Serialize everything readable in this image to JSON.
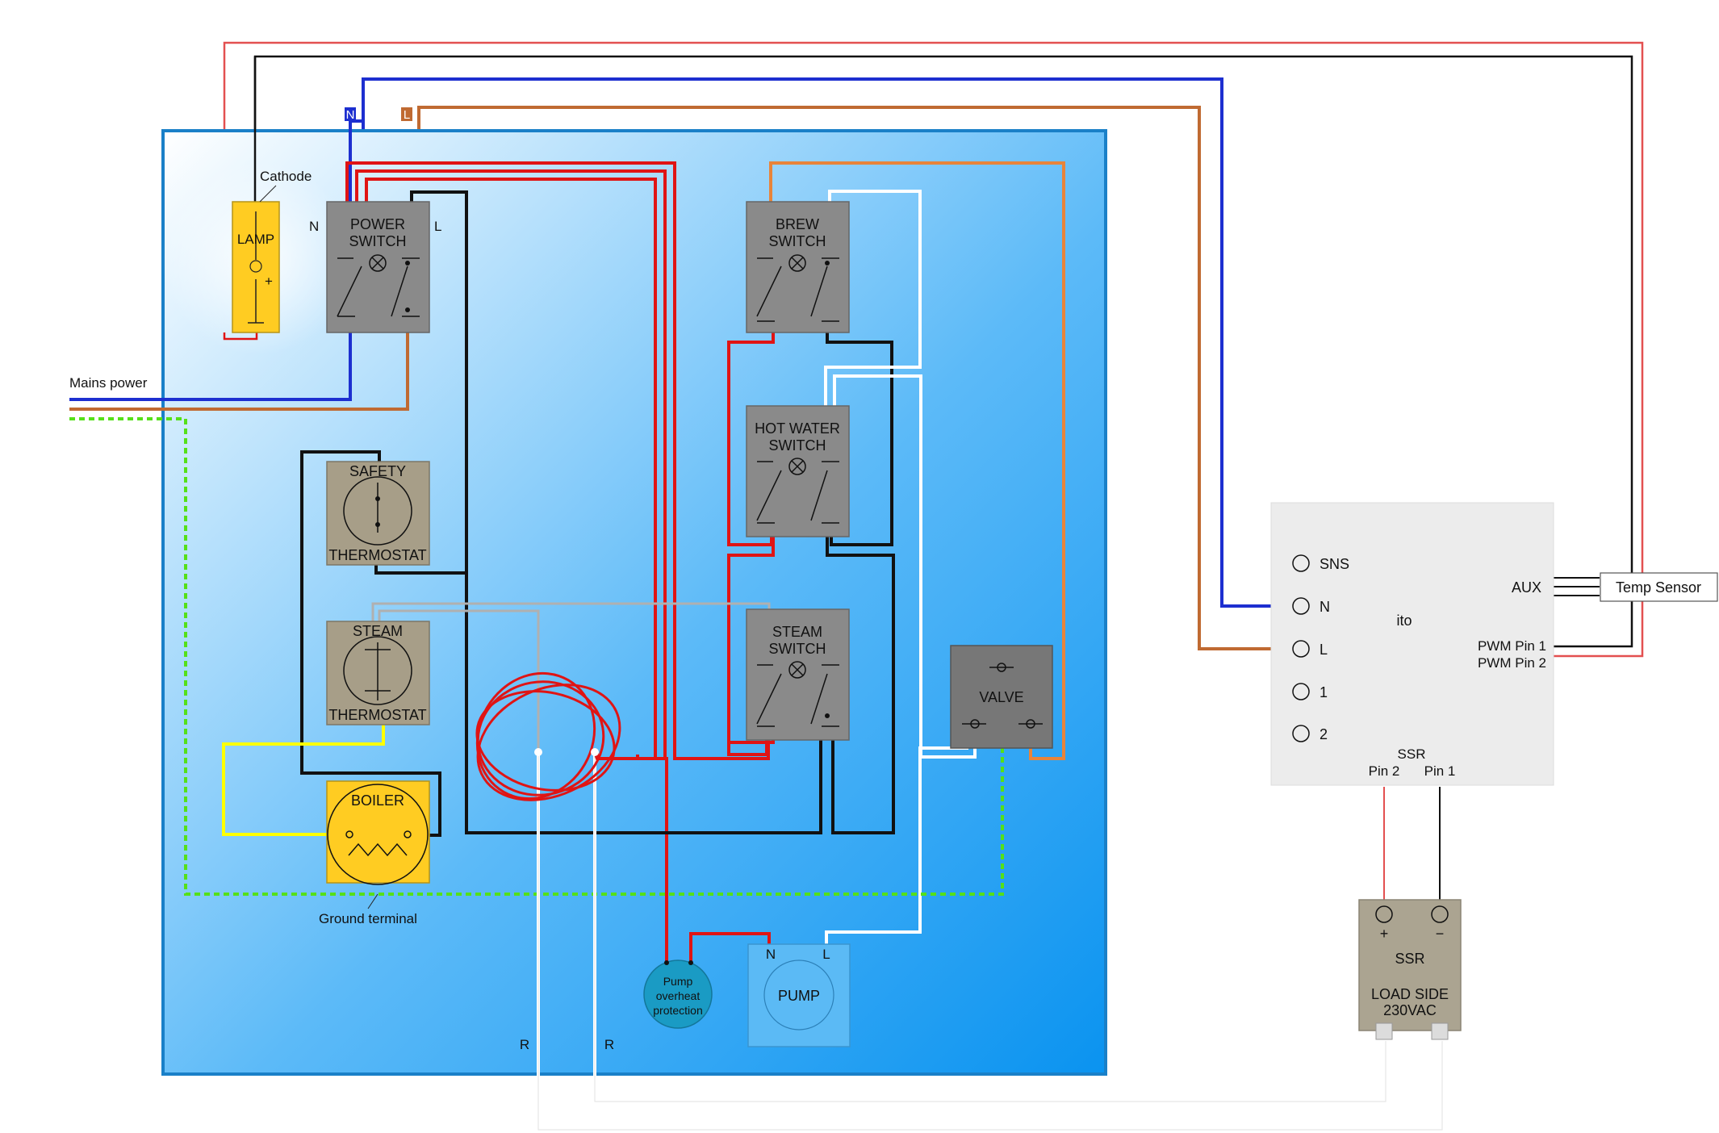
{
  "labels": {
    "n_tag": "N",
    "l_tag": "L",
    "cathode": "Cathode",
    "mains_power": "Mains power",
    "ground_terminal": "Ground terminal",
    "r_left": "R",
    "r_right": "R"
  },
  "lamp": {
    "label": "LAMP",
    "plus": "+"
  },
  "power_switch": {
    "line1": "POWER",
    "line2": "SWITCH",
    "n": "N",
    "l": "L"
  },
  "brew_switch": {
    "line1": "BREW",
    "line2": "SWITCH"
  },
  "hot_water_switch": {
    "line1": "HOT WATER",
    "line2": "SWITCH"
  },
  "steam_switch": {
    "line1": "STEAM",
    "line2": "SWITCH"
  },
  "safety_thermostat": {
    "top": "SAFETY",
    "bottom": "THERMOSTAT"
  },
  "steam_thermostat": {
    "top": "STEAM",
    "bottom": "THERMOSTAT"
  },
  "boiler": {
    "label": "BOILER"
  },
  "valve": {
    "label": "VALVE"
  },
  "pump_protection": {
    "line1": "Pump",
    "line2": "overheat",
    "line3": "protection"
  },
  "pump": {
    "label": "PUMP",
    "n": "N",
    "l": "L"
  },
  "controller": {
    "name": "ito",
    "pins": [
      "SNS",
      "N",
      "L",
      "1",
      "2"
    ],
    "aux": "AUX",
    "pwm1": "PWM Pin 1",
    "pwm2": "PWM Pin 2",
    "ssr": "SSR",
    "ssr_pin2": "Pin 2",
    "ssr_pin1": "Pin 1"
  },
  "temp_sensor": {
    "label": "Temp Sensor"
  },
  "ssr": {
    "plus": "+",
    "minus": "−",
    "label": "SSR",
    "load1": "LOAD SIDE",
    "load2": "230VAC"
  },
  "colors": {
    "panel_dark": "#0a93f0",
    "panel_light": "#ffffff",
    "panel_border": "#1a80c8",
    "neutral": "#1d2fd0",
    "live": "#c06a32",
    "switched": "#e01414",
    "return": "#111111",
    "ground": "#55e018",
    "aux": "#ffff00",
    "lamp_yellow": "#ffcc22",
    "gray_switch": "#8a8a8a",
    "thermostat": "#a79e88",
    "valve": "#777777",
    "pump": "#5bbaf5",
    "pump_protection": "#1a9bc4",
    "controller": "#ececec",
    "ssr_body": "#aba491"
  }
}
